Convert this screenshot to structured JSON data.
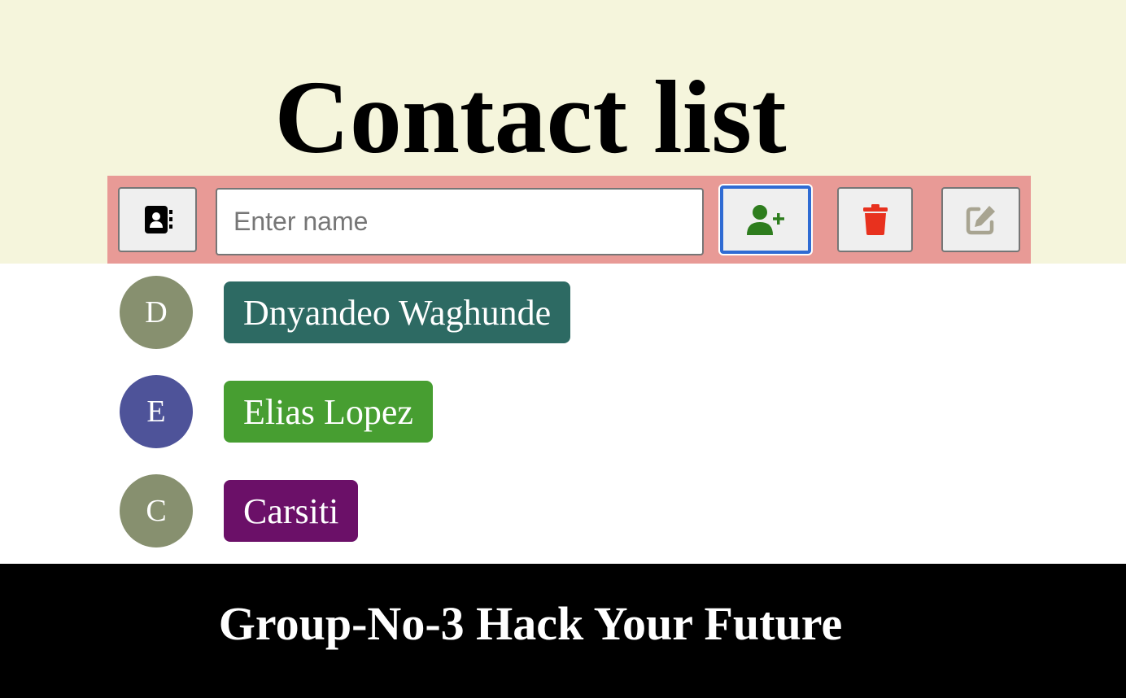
{
  "header": {
    "title": "Contact list"
  },
  "toolbar": {
    "contacts_icon": "address-book-icon",
    "input_placeholder": "Enter name",
    "input_value": "",
    "add_icon": "user-plus-icon",
    "delete_icon": "trash-icon",
    "edit_icon": "edit-icon",
    "colors": {
      "background": "#e89a96",
      "add_icon": "#2e7d1e",
      "delete_icon": "#e8311e",
      "edit_icon": "#a8a491",
      "focus_ring": "#2f6bd3"
    }
  },
  "contacts": [
    {
      "initial": "D",
      "name": "Dnyandeo Waghunde",
      "avatar_color": "#87906f",
      "pill_color": "#2d6a63"
    },
    {
      "initial": "E",
      "name": "Elias Lopez",
      "avatar_color": "#4e5399",
      "pill_color": "#479e31"
    },
    {
      "initial": "C",
      "name": "Carsiti",
      "avatar_color": "#87906f",
      "pill_color": "#6b1068"
    }
  ],
  "footer": {
    "text": "Group-No-3 Hack Your Future"
  },
  "colors": {
    "header_bg": "#f5f5dc",
    "footer_bg": "#000000"
  }
}
